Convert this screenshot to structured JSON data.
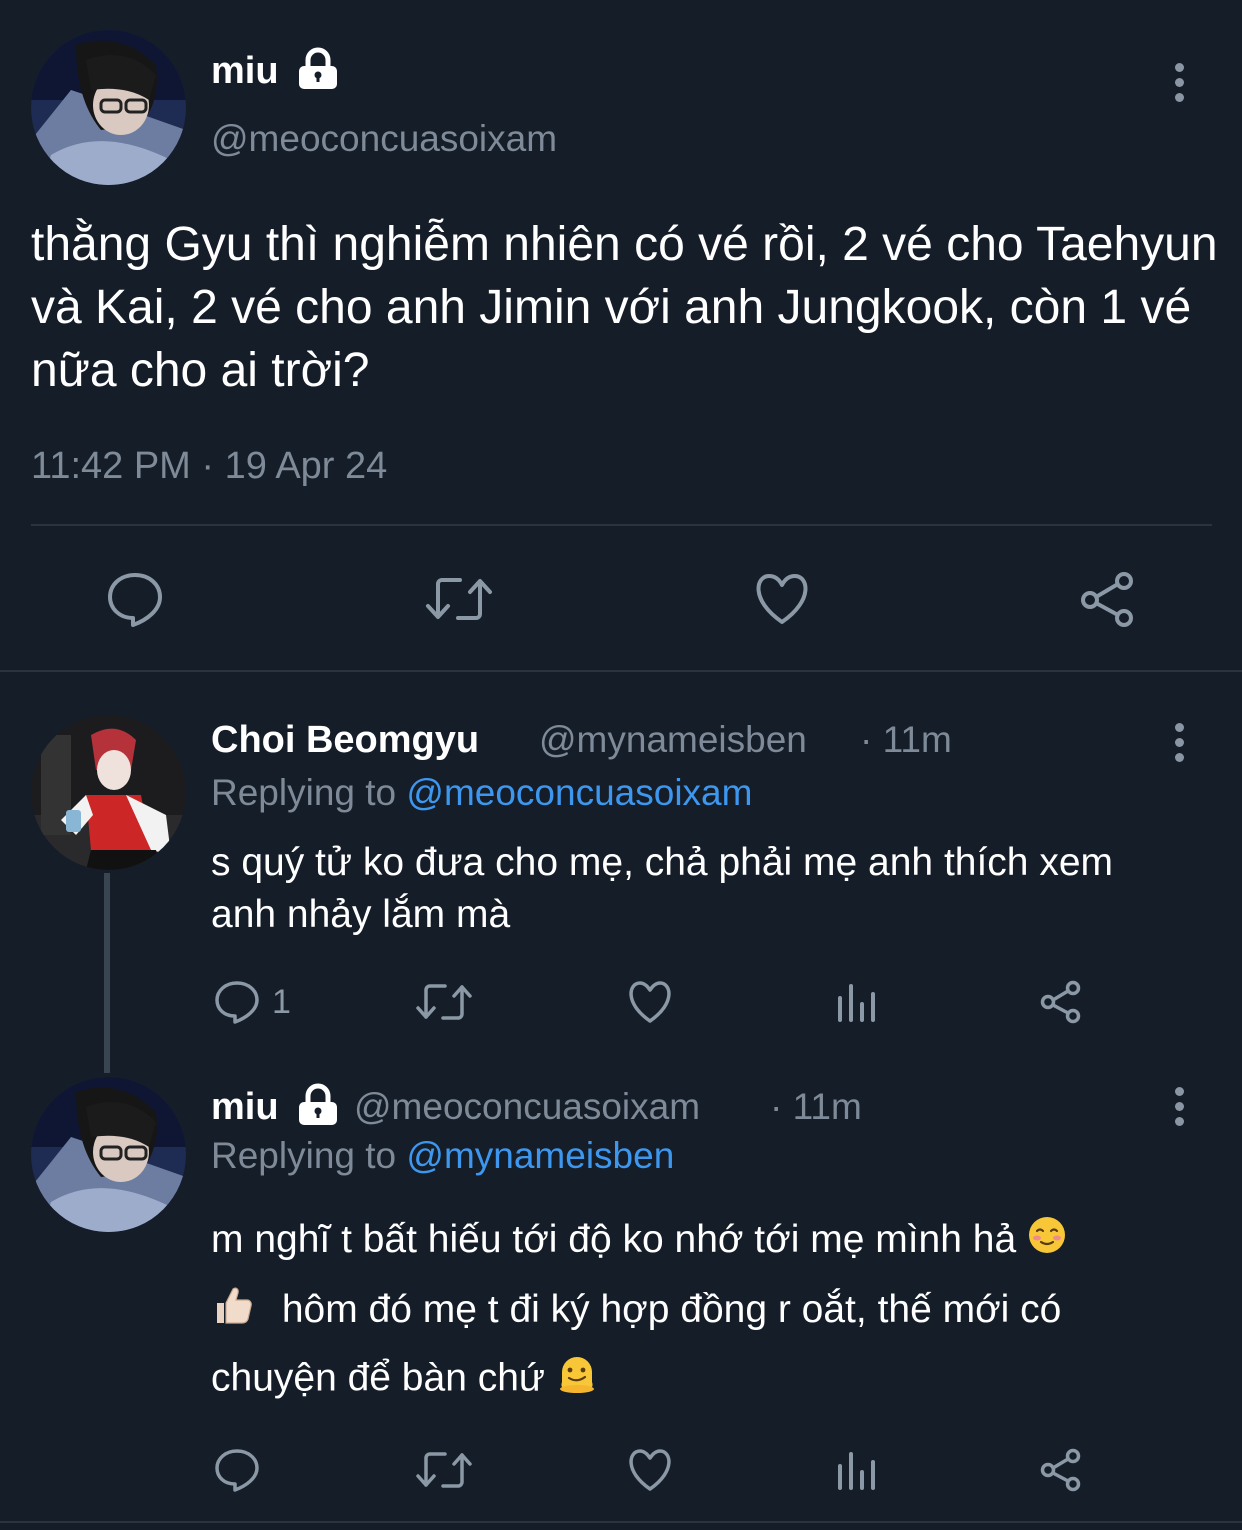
{
  "main_tweet": {
    "author_name": "miu",
    "handle": "@meoconcuasoixam",
    "text": "thằng Gyu thì nghiễm nhiên có vé rồi, 2 vé cho Taehyun và Kai, 2 vé cho anh Jimin với anh Jungkook, còn 1 vé nữa cho ai trời?",
    "timestamp": "11:42 PM · 19 Apr 24",
    "actions": [
      "reply-icon",
      "retweet-icon",
      "like-icon",
      "share-icon"
    ]
  },
  "reply1": {
    "author_name": "Choi Beomgyu",
    "handle": "@mynameisben",
    "time": "· 11m",
    "replying_prefix": "Replying to",
    "replying_to": "@meoconcuasoixam",
    "text": "s quý tử ko đưa cho mẹ, chả phải mẹ anh thích xem anh nhảy lắm mà",
    "reply_count": "1"
  },
  "reply2": {
    "author_name": "miu",
    "handle": "@meoconcuasoixam",
    "time": "· 11m",
    "replying_prefix": "Replying to",
    "replying_to": "@mynameisben",
    "text_line1": "m nghĩ t bất hiếu tới độ ko nhớ tới mẹ mình hả",
    "text_line2": "hôm đó mẹ t đi ký hợp đồng r oắt, thế mới có",
    "text_line3": "chuyện để bàn chứ"
  },
  "colors": {
    "background": "#151d29",
    "accent": "#3d97ee",
    "muted": "#7e8a98",
    "icon": "#8b98a5"
  }
}
